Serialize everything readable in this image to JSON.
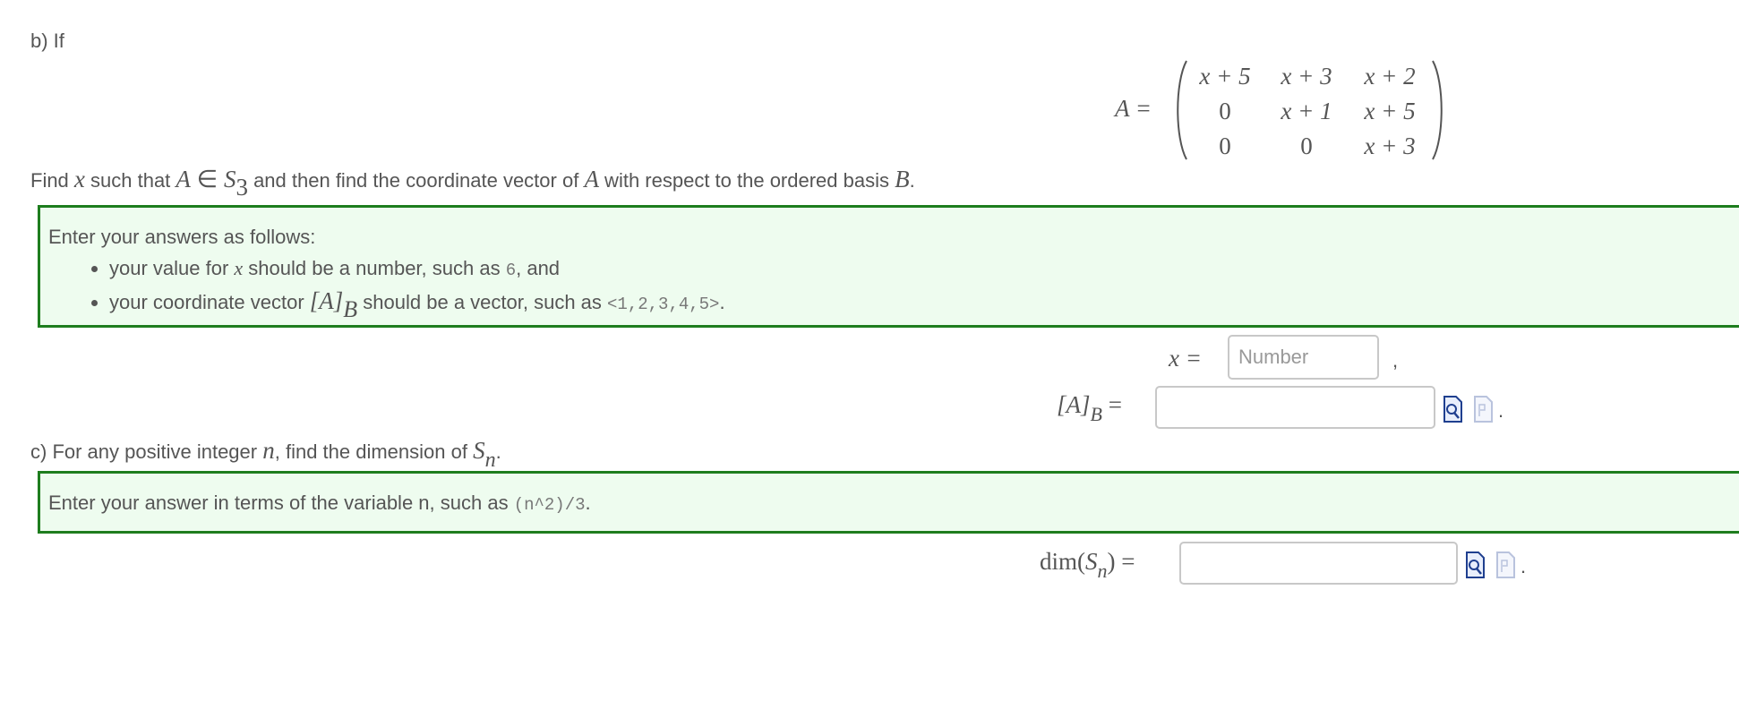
{
  "part_b": {
    "label": "b) If",
    "matrix": {
      "lhs": "A =",
      "rows": [
        [
          "x + 5",
          "x + 3",
          "x + 2"
        ],
        [
          "0",
          "x + 1",
          "x + 5"
        ],
        [
          "0",
          "0",
          "x + 3"
        ]
      ]
    },
    "find": {
      "t1": "Find ",
      "x": "x",
      "t2": " such that ",
      "A": "A",
      "in": " ∈ ",
      "S": "S",
      "sub3": "3",
      "t3": " and then find the coordinate vector of ",
      "A2": "A",
      "t4": " with respect to the ordered basis ",
      "B": "B",
      "t5": "."
    },
    "instructions": {
      "lead": "Enter your answers as follows:",
      "item1": {
        "t1": "your value for ",
        "x": "x",
        "t2": " should be a number, such as ",
        "code": "6",
        "t3": ", and"
      },
      "item2": {
        "t1": "your coordinate vector ",
        "math": "[A]",
        "sub": "B",
        "t2": " should be a vector, such as ",
        "code": "<1,2,3,4,5>",
        "t3": "."
      }
    },
    "x_answer": {
      "label": "x =",
      "placeholder": "Number",
      "value": "",
      "suffix": ","
    },
    "vector_answer": {
      "label": "[A]",
      "sub": "B",
      "eq": " =",
      "value": "",
      "suffix": "."
    }
  },
  "part_c": {
    "q": {
      "t1": "c) For any positive integer ",
      "n": "n",
      "t2": ", find the dimension of ",
      "S": "S",
      "sub": "n",
      "t3": "."
    },
    "instruction": {
      "t1": "Enter your answer in terms of the variable n, such as ",
      "code": "(n^2)/3",
      "t2": "."
    },
    "dim_answer": {
      "label": "dim(",
      "S": "S",
      "sub": "n",
      "close": ") =",
      "value": "",
      "suffix": "."
    }
  },
  "icons": [
    "preview-icon",
    "equation-editor-icon"
  ],
  "colors": {
    "box_border": "#1e7d1e",
    "box_bg": "#eefcef",
    "text": "#555555",
    "icon_blue": "#1f3f8f"
  }
}
